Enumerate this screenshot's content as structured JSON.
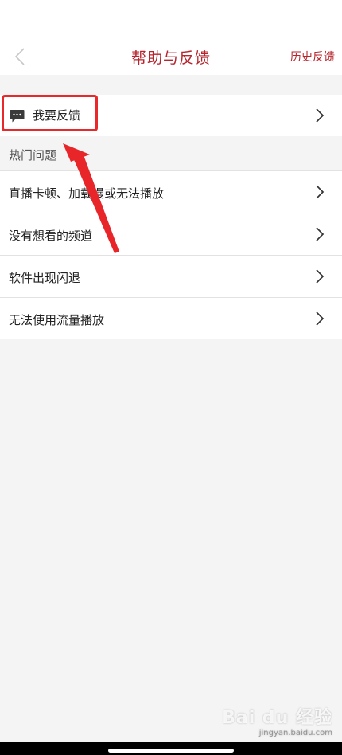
{
  "header": {
    "title": "帮助与反馈",
    "history_label": "历史反馈"
  },
  "feedback": {
    "label": "我要反馈",
    "icon": "chat-bubble-icon"
  },
  "hot_questions": {
    "header": "热门问题",
    "items": [
      {
        "label": "直播卡顿、加载慢或无法播放"
      },
      {
        "label": "没有想看的频道"
      },
      {
        "label": "软件出现闪退"
      },
      {
        "label": "无法使用流量播放"
      }
    ]
  },
  "watermark": {
    "logo": "Bai du 经验",
    "url": "jingyan.baidu.com"
  },
  "colors": {
    "accent": "#b5252d",
    "highlight": "#e8282b",
    "background": "#f4f4f4"
  }
}
